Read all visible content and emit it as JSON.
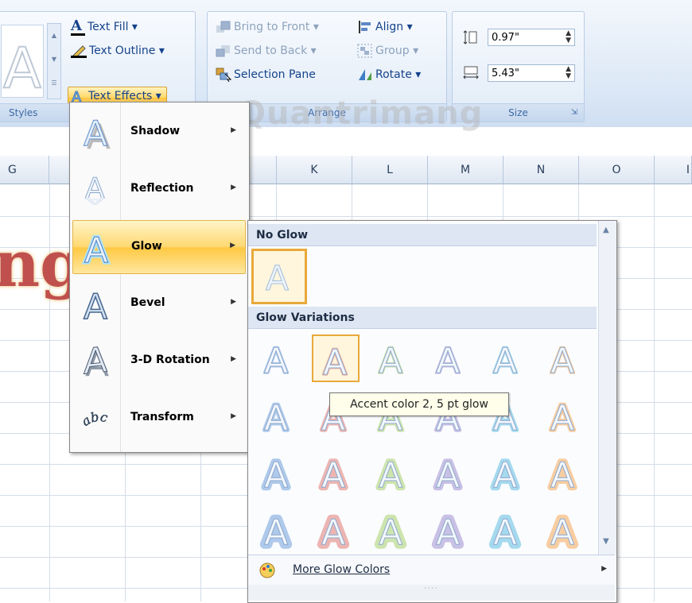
{
  "ribbon": {
    "wordart_styles": {
      "label": "Styles"
    },
    "text_fill": "Text Fill",
    "text_outline": "Text Outline",
    "text_effects": "Text Effects",
    "arrange": {
      "label": "Arrange",
      "bring_to_front": "Bring to Front",
      "send_to_back": "Send to Back",
      "selection_pane": "Selection Pane",
      "align": "Align",
      "group": "Group",
      "rotate": "Rotate"
    },
    "size": {
      "label": "Size",
      "height_value": "0.97\"",
      "width_value": "5.43\""
    }
  },
  "sheet": {
    "columns": [
      "G",
      "",
      "",
      "",
      "K",
      "L",
      "M",
      "N",
      "O",
      "I"
    ],
    "wordart_fragment": "ng"
  },
  "text_effects_menu": {
    "items": [
      {
        "label": "Shadow",
        "icon": "shadow-a-icon"
      },
      {
        "label": "Reflection",
        "icon": "reflection-a-icon"
      },
      {
        "label": "Glow",
        "icon": "glow-a-icon"
      },
      {
        "label": "Bevel",
        "icon": "bevel-a-icon"
      },
      {
        "label": "3-D Rotation",
        "icon": "rotation-a-icon"
      },
      {
        "label": "Transform",
        "icon": "transform-abc-icon"
      }
    ]
  },
  "glow_gallery": {
    "no_glow_header": "No Glow",
    "variations_header": "Glow Variations",
    "accent_colors": [
      "#6f9fd8",
      "#e07a72",
      "#a8cf6c",
      "#a08ed0",
      "#5fbce0",
      "#f4a656"
    ],
    "more_colors": "More Glow Colors",
    "tooltip": "Accent color 2, 5 pt glow"
  },
  "watermark": "Quantrimang"
}
